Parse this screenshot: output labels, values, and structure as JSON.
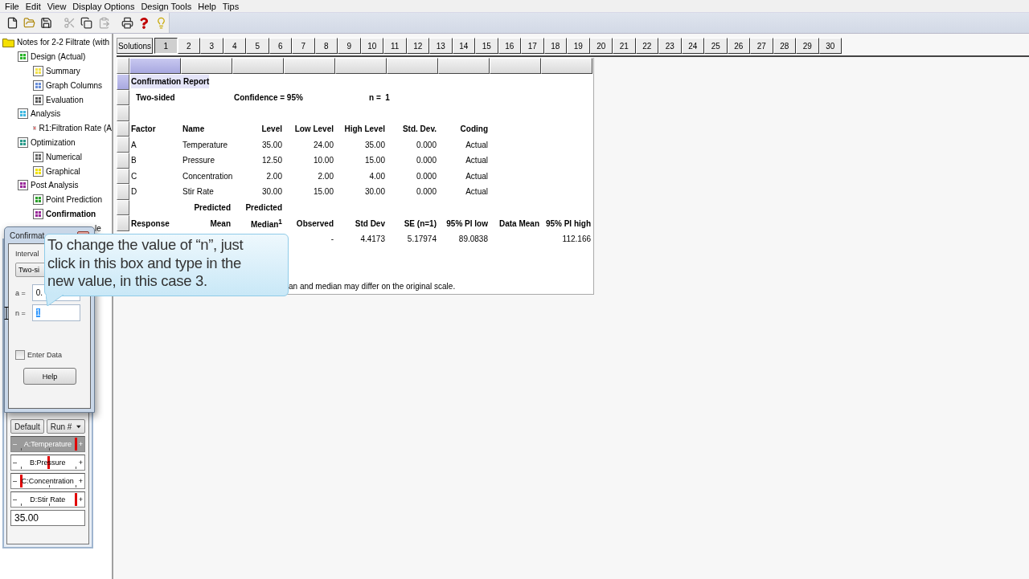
{
  "menu": [
    "File",
    "Edit",
    "View",
    "Display Options",
    "Design Tools",
    "Help",
    "Tips"
  ],
  "toolbar": [
    {
      "kind": "new",
      "disabled": false
    },
    {
      "kind": "open",
      "disabled": false
    },
    {
      "kind": "save",
      "disabled": false
    },
    {
      "kind": "cut",
      "disabled": true
    },
    {
      "kind": "copy",
      "disabled": false
    },
    {
      "kind": "paste",
      "disabled": true
    },
    {
      "kind": "print",
      "disabled": false
    },
    {
      "kind": "help",
      "disabled": false
    },
    {
      "kind": "tips",
      "disabled": false
    }
  ],
  "tree": {
    "label": "Notes for 2-2 Filtrate (with",
    "kind": "folder",
    "selected": false,
    "children": [
      {
        "label": "Design (Actual)",
        "kind": "design",
        "selected": false,
        "children": [
          {
            "label": "Summary",
            "kind": "summary",
            "selected": false
          },
          {
            "label": "Graph Columns",
            "kind": "graph",
            "selected": false
          },
          {
            "label": "Evaluation",
            "kind": "evaluation",
            "selected": false
          }
        ]
      },
      {
        "label": "Analysis",
        "kind": "analysis",
        "selected": false,
        "children": [
          {
            "label": "R1:Filtration Rate (A",
            "kind": "response",
            "selected": false
          }
        ]
      },
      {
        "label": "Optimization",
        "kind": "optimization",
        "selected": false,
        "children": [
          {
            "label": "Numerical",
            "kind": "numerical",
            "selected": false
          },
          {
            "label": "Graphical",
            "kind": "graphical",
            "selected": false
          }
        ]
      },
      {
        "label": "Post Analysis",
        "kind": "post",
        "selected": false,
        "children": [
          {
            "label": "Point Prediction",
            "kind": "point",
            "selected": false
          },
          {
            "label": "Confirmation",
            "kind": "confirmation",
            "selected": true
          },
          {
            "label": "le",
            "kind": "obscured",
            "selected": false
          }
        ]
      }
    ]
  },
  "factors_tool": {
    "default_button": "Default",
    "run_select": "Run #",
    "factors": [
      {
        "label": "A:Temperature",
        "minus": "–",
        "plus": "+",
        "selected": true,
        "level": 1
      },
      {
        "label": "B:Pressure",
        "minus": "–",
        "plus": "+",
        "selected": false,
        "level": 0.5
      },
      {
        "label": "C:Concentration",
        "minus": "–",
        "plus": "+",
        "selected": false,
        "level": 0
      },
      {
        "label": "D:Stir Rate",
        "minus": "–",
        "plus": "+",
        "selected": false,
        "level": 1
      }
    ],
    "value": "35.00"
  },
  "dialog": {
    "title": "Confirmat",
    "interval_label": "Interval",
    "interval_value": "Two-si",
    "alpha_label": "a =",
    "alpha_value": "0.",
    "n_label": "n =",
    "n_value": "1",
    "enter_data": {
      "label": "Enter Data",
      "checked": false
    },
    "help_button": "Help"
  },
  "callout": {
    "text": "To change the value of “n”, just click in this box and type in the new value, in this case 3."
  },
  "solutions": {
    "label": "Solutions",
    "tabs": [
      {
        "label": "1",
        "selected": true
      },
      {
        "label": "2",
        "selected": false
      },
      {
        "label": "3",
        "selected": false
      },
      {
        "label": "4",
        "selected": false
      },
      {
        "label": "5",
        "selected": false
      },
      {
        "label": "6",
        "selected": false
      },
      {
        "label": "7",
        "selected": false
      },
      {
        "label": "8",
        "selected": false
      },
      {
        "label": "9",
        "selected": false
      },
      {
        "label": "10",
        "selected": false
      },
      {
        "label": "11",
        "selected": false
      },
      {
        "label": "12",
        "selected": false
      },
      {
        "label": "13",
        "selected": false
      },
      {
        "label": "14",
        "selected": false
      },
      {
        "label": "15",
        "selected": false
      },
      {
        "label": "16",
        "selected": false
      },
      {
        "label": "17",
        "selected": false
      },
      {
        "label": "18",
        "selected": false
      },
      {
        "label": "19",
        "selected": false
      },
      {
        "label": "20",
        "selected": false
      },
      {
        "label": "21",
        "selected": false
      },
      {
        "label": "22",
        "selected": false
      },
      {
        "label": "23",
        "selected": false
      },
      {
        "label": "24",
        "selected": false
      },
      {
        "label": "25",
        "selected": false
      },
      {
        "label": "26",
        "selected": false
      },
      {
        "label": "27",
        "selected": false
      },
      {
        "label": "28",
        "selected": false
      },
      {
        "label": "29",
        "selected": false
      },
      {
        "label": "30",
        "selected": false
      }
    ]
  },
  "report": {
    "column_headers": [
      {
        "selected": true
      },
      {
        "selected": false
      },
      {
        "selected": false
      },
      {
        "selected": false
      },
      {
        "selected": false
      },
      {
        "selected": false
      },
      {
        "selected": false
      },
      {
        "selected": false
      },
      {
        "selected": false
      }
    ],
    "rows": [
      {
        "kind": "title",
        "selected": true,
        "column_1": "Confirmation Report"
      },
      {
        "kind": "settings",
        "selected": false,
        "column_1": "Two-sided",
        "column_3": "Confidence = 95%",
        "column_5": "n =  1"
      },
      {
        "kind": "blank",
        "selected": false
      },
      {
        "kind": "factor_heading",
        "selected": false,
        "column_1": "Factor",
        "column_2": "Name",
        "column_3": "Level",
        "column_4": "Low Level",
        "column_5": "High Level",
        "column_6": "Std. Dev.",
        "column_7": "Coding"
      },
      {
        "kind": "factor",
        "selected": false,
        "column_1": "A",
        "column_2": "Temperature",
        "column_3": "35.00",
        "column_4": "24.00",
        "column_5": "35.00",
        "column_6": "0.000",
        "column_7": "Actual"
      },
      {
        "kind": "factor",
        "selected": false,
        "column_1": "B",
        "column_2": "Pressure",
        "column_3": "12.50",
        "column_4": "10.00",
        "column_5": "15.00",
        "column_6": "0.000",
        "column_7": "Actual"
      },
      {
        "kind": "factor",
        "selected": false,
        "column_1": "C",
        "column_2": "Concentration",
        "column_3": "2.00",
        "column_4": "2.00",
        "column_5": "4.00",
        "column_6": "0.000",
        "column_7": "Actual"
      },
      {
        "kind": "factor",
        "selected": false,
        "column_1": "D",
        "column_2": "Stir Rate",
        "column_3": "30.00",
        "column_4": "15.00",
        "column_5": "30.00",
        "column_6": "0.000",
        "column_7": "Actual"
      },
      {
        "kind": "response_heading",
        "selected": false,
        "column_2": "Predicted",
        "column_3": "Predicted"
      },
      {
        "kind": "response_heading",
        "selected": false,
        "column_1": "Response",
        "column_2": "Mean",
        "column_3": "Median$^{1}$",
        "column_4": "Observed",
        "column_5": "Std Dev",
        "column_6": "SE (n=1)",
        "column_7": "95% PI low",
        "column_8": "Data Mean",
        "column_9": "95% PI high"
      },
      {
        "kind": "response",
        "column_4": "-",
        "column_5": "4.4173",
        "column_6": "5.17974",
        "column_7": "89.0838",
        "column_9": "112.166"
      },
      {
        "kind": "blank"
      },
      {
        "kind": "blank"
      },
      {
        "kind": "note",
        "column_4": "an and median may differ on the original scale."
      }
    ]
  }
}
